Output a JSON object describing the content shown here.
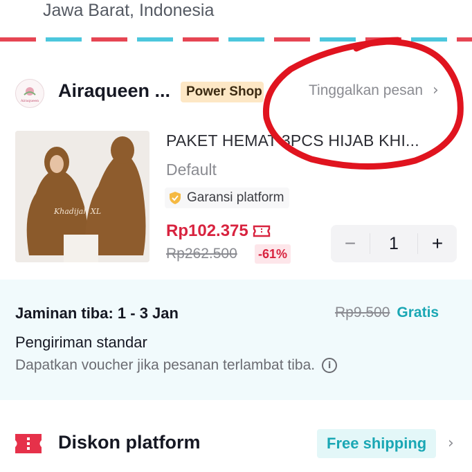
{
  "address": {
    "line": "Jawa Barat, Indonesia"
  },
  "shop": {
    "name": "Airaqueen ...",
    "badge": "Power Shop",
    "logo_text": "Airaqueen",
    "leave_message": "Tinggalkan pesan"
  },
  "product": {
    "title": "PAKET HEMAT 3PCS HIJAB KHI...",
    "variant": "Default",
    "guarantee": "Garansi platform",
    "price": "Rp102.375",
    "original_price": "Rp262.500",
    "discount": "-61%",
    "image_caption": "Khadijah XL",
    "quantity": "1",
    "decrement": "−",
    "increment": "+"
  },
  "shipping": {
    "arrival": "Jaminan tiba: 1 - 3 Jan",
    "old_fee": "Rp9.500",
    "free_label": "Gratis",
    "method": "Pengiriman standar",
    "voucher_note": "Dapatkan voucher jika pesanan terlambat tiba."
  },
  "discount": {
    "label": "Diskon platform",
    "tag": "Free shipping"
  },
  "colors": {
    "price_red": "#d8233f",
    "teal": "#1aa7b4",
    "annotation_red": "#e0141f",
    "badge_bg": "#fde7c5"
  }
}
